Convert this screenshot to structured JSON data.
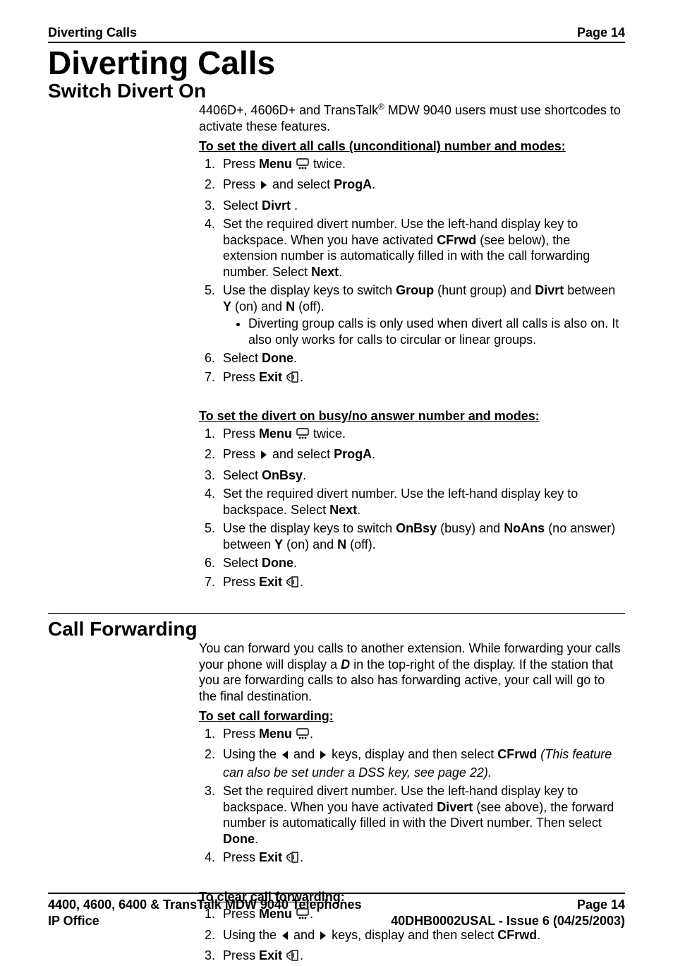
{
  "header": {
    "left": "Diverting Calls",
    "right": "Page 14"
  },
  "title": "Diverting Calls",
  "section1": {
    "heading": "Switch Divert On",
    "intro_before_sup": "4406D+, 4606D+ and TransTalk",
    "intro_sup": "®",
    "intro_after_sup": " MDW 9040 users must use shortcodes to activate these features.",
    "procA_title": "To set the divert all calls (unconditional) number and modes:",
    "s1_a": "Press ",
    "s1_b": "Menu",
    "s1_c": " twice.",
    "s2_a": "Press ",
    "s2_b": " and select ",
    "s2_c": "ProgA",
    "s2_d": ".",
    "s3_a": "Select ",
    "s3_b": "Divrt",
    "s3_c": " .",
    "s4_a": "Set the required divert number. Use the left-hand display key to backspace. When you have activated ",
    "s4_b": "CFrwd",
    "s4_c": " (see below), the extension number is automatically filled in with the call forwarding number.  Select ",
    "s4_d": "Next",
    "s4_e": ".",
    "s5_a": "Use the display keys to switch ",
    "s5_b": "Group",
    "s5_c": " (hunt group) and ",
    "s5_d": "Divrt",
    "s5_e": " between ",
    "s5_f": "Y",
    "s5_g": " (on) and ",
    "s5_h": "N",
    "s5_i": " (off).",
    "s5_sub": "Diverting group calls is only used when divert all calls is also on. It also only works for calls to circular or linear groups.",
    "s6_a": "Select ",
    "s6_b": "Done",
    "s6_c": ".",
    "s7_a": "Press ",
    "s7_b": "Exit",
    "s7_c": ".",
    "procB_title": "To set the divert on busy/no answer number and modes:",
    "b1_a": "Press ",
    "b1_b": "Menu",
    "b1_c": " twice.",
    "b2_a": "Press ",
    "b2_b": " and select ",
    "b2_c": "ProgA",
    "b2_d": ".",
    "b3_a": "Select ",
    "b3_b": "OnBsy",
    "b3_c": ".",
    "b4_a": "Set the required divert number. Use the left-hand display key to backspace. Select ",
    "b4_b": "Next",
    "b4_c": ".",
    "b5_a": "Use the display keys to switch ",
    "b5_b": "OnBsy",
    "b5_c": " (busy) and ",
    "b5_d": "NoAns",
    "b5_e": " (no answer) between ",
    "b5_f": "Y",
    "b5_g": " (on) and ",
    "b5_h": "N",
    "b5_i": " (off).",
    "b6_a": "Select ",
    "b6_b": "Done",
    "b6_c": ".",
    "b7_a": "Press ",
    "b7_b": "Exit",
    "b7_c": "."
  },
  "section2": {
    "heading": "Call Forwarding",
    "intro_a": "You can forward you calls to another extension. While forwarding your calls your phone will display a ",
    "intro_b": "D",
    "intro_c": " in the top-right of the display.  If the station that you are forwarding calls to also has forwarding active, your call will go to the final destination.",
    "procA_title": "To set call forwarding:",
    "s1_a": "Press ",
    "s1_b": "Menu",
    "s1_c": ".",
    "s2_a": "Using the ",
    "s2_b": " and ",
    "s2_c": " keys, display and then select ",
    "s2_d": "CFrwd",
    "s2_e": " (This feature can also be set under a DSS key, see page 22).",
    "s3_a": "Set the required divert number. Use the left-hand display key to backspace.  When you have activated ",
    "s3_b": "Divert",
    "s3_c": " (see above), the forward number is automatically filled in with the Divert number. Then select ",
    "s3_d": "Done",
    "s3_e": ".",
    "s4_a": "Press ",
    "s4_b": "Exit",
    "s4_c": ".",
    "procB_title": "To clear call forwarding:",
    "c1_a": "Press ",
    "c1_b": "Menu",
    "c1_c": ".",
    "c2_a": "Using the ",
    "c2_b": " and ",
    "c2_c": " keys, display and then select ",
    "c2_d": "CFrwd",
    "c2_e": ".",
    "c3_a": "Press ",
    "c3_b": "Exit",
    "c3_c": "."
  },
  "footer": {
    "row1_left": "4400, 4600, 6400 & TransTalk MDW 9040 Telephones",
    "row1_right": "Page 14",
    "row2_left": "IP Office",
    "row2_right": "40DHB0002USAL - Issue 6 (04/25/2003)"
  }
}
